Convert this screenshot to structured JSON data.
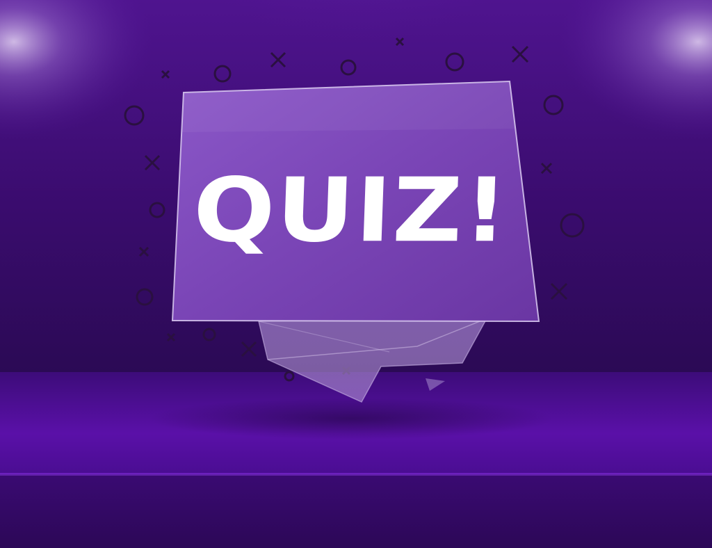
{
  "headline": {
    "text": "QUIZ!"
  },
  "icons": {
    "decorations": "tic-tac-toe-x-and-o-icons",
    "lighting": "spotlight-glow",
    "bubble": "speech-bubble"
  },
  "colors": {
    "background_top": "#5a1aa3",
    "background_dark": "#2a0a52",
    "floor": "#5a0fa8",
    "bubble_fill": "#8a55c2",
    "decoration_stroke": "#2a1040",
    "headline_text": "#ffffff"
  }
}
